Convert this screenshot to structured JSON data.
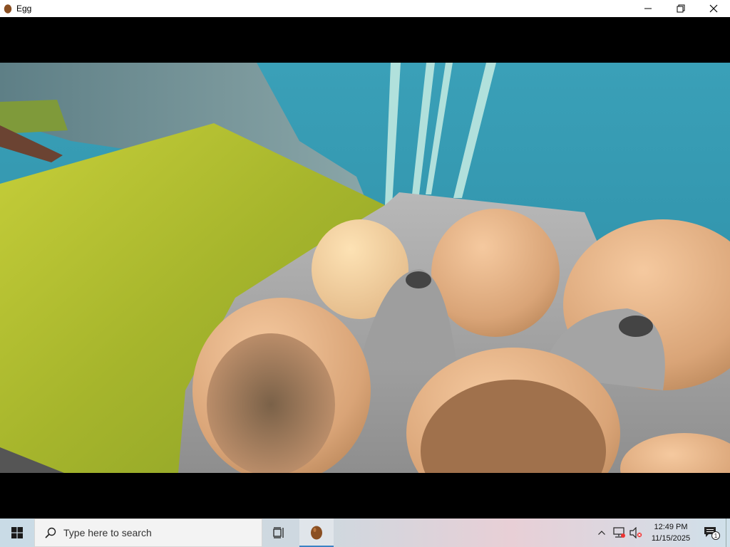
{
  "window": {
    "title": "Egg",
    "icon": "egg-icon",
    "controls": [
      "minimize-icon",
      "restore-icon",
      "close-icon"
    ]
  },
  "game": {
    "scene": "egg-carton-on-grass-cliff",
    "colors": {
      "sea": "#2f8fa6",
      "cliff": "#6f8f95",
      "grass": "#b9c432",
      "carton": "#a9a9a9",
      "egg": "#e8b68a",
      "letterbox": "#000000"
    }
  },
  "taskbar": {
    "start_icon": "windows-logo-icon",
    "search_placeholder": "Type here to search",
    "taskview_icon": "task-view-icon",
    "pinned_app_icon": "egg-icon",
    "tray": {
      "icons": [
        "chevron-up-icon",
        "network-icon",
        "volume-muted-icon"
      ],
      "time": "12:49 PM",
      "date": "11/15/2025",
      "notification_count": "1"
    }
  }
}
